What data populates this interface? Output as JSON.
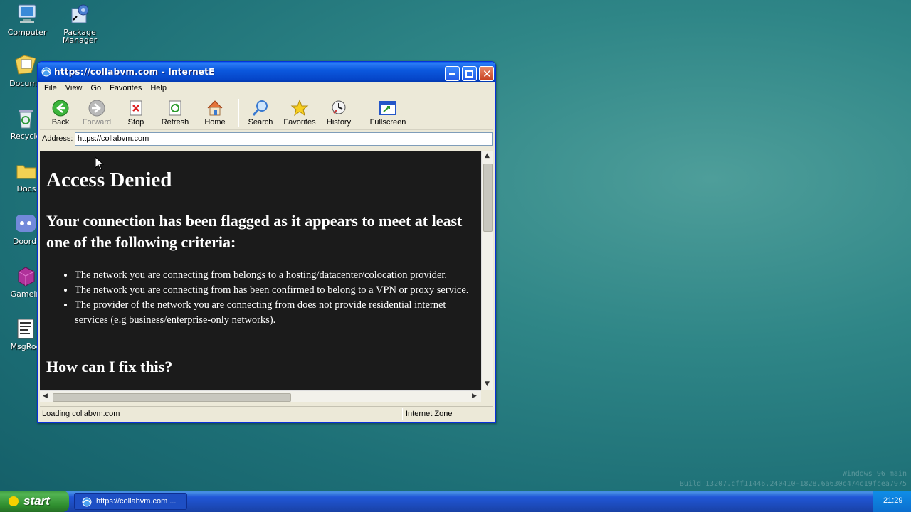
{
  "desktop": {
    "icons": [
      {
        "label": "Computer",
        "icon": "computer-icon"
      },
      {
        "label": "Package Manager",
        "icon": "package-manager-icon"
      },
      {
        "label": "Docume",
        "icon": "documents-icon"
      },
      {
        "label": "Recycle",
        "icon": "recycle-bin-icon"
      },
      {
        "label": "Docs",
        "icon": "folder-icon"
      },
      {
        "label": "Doordi",
        "icon": "discord-icon"
      },
      {
        "label": "Gamein",
        "icon": "game-icon"
      },
      {
        "label": "MsgRoo",
        "icon": "msgroom-icon"
      }
    ],
    "watermark_line1": "Windows 96 main",
    "watermark_line2": "Build 13207.cff11446.240410-1828.6a630c474c19fcea7975"
  },
  "window": {
    "title": "https://collabvm.com - InternetE",
    "menu": [
      "File",
      "View",
      "Go",
      "Favorites",
      "Help"
    ],
    "toolbar": {
      "back": "Back",
      "forward": "Forward",
      "stop": "Stop",
      "refresh": "Refresh",
      "home": "Home",
      "search": "Search",
      "favorites": "Favorites",
      "history": "History",
      "fullscreen": "Fullscreen"
    },
    "address": {
      "label": "Address:",
      "value": "https://collabvm.com"
    },
    "page": {
      "heading": "Access Denied",
      "subheading": "Your connection has been flagged as it appears to meet at least one of the following criteria:",
      "criteria": [
        "The network you are connecting from belongs to a hosting/datacenter/colocation provider.",
        "The network you are connecting from has been confirmed to belong to a VPN or proxy service.",
        "The provider of the network you are connecting from does not provide residential internet services (e.g business/enterprise-only networks)."
      ],
      "fix_heading": "How can I fix this?"
    },
    "status": {
      "text": "Loading collabvm.com",
      "zone": "Internet Zone"
    }
  },
  "taskbar": {
    "start_label": "start",
    "task_label": "https://collabvm.com ...",
    "clock": "21:29"
  },
  "colors": {
    "titlebar": "#0c59df",
    "page_bg": "#1b1b1b",
    "taskbar": "#2157d7",
    "start": "#3c9a3c"
  }
}
